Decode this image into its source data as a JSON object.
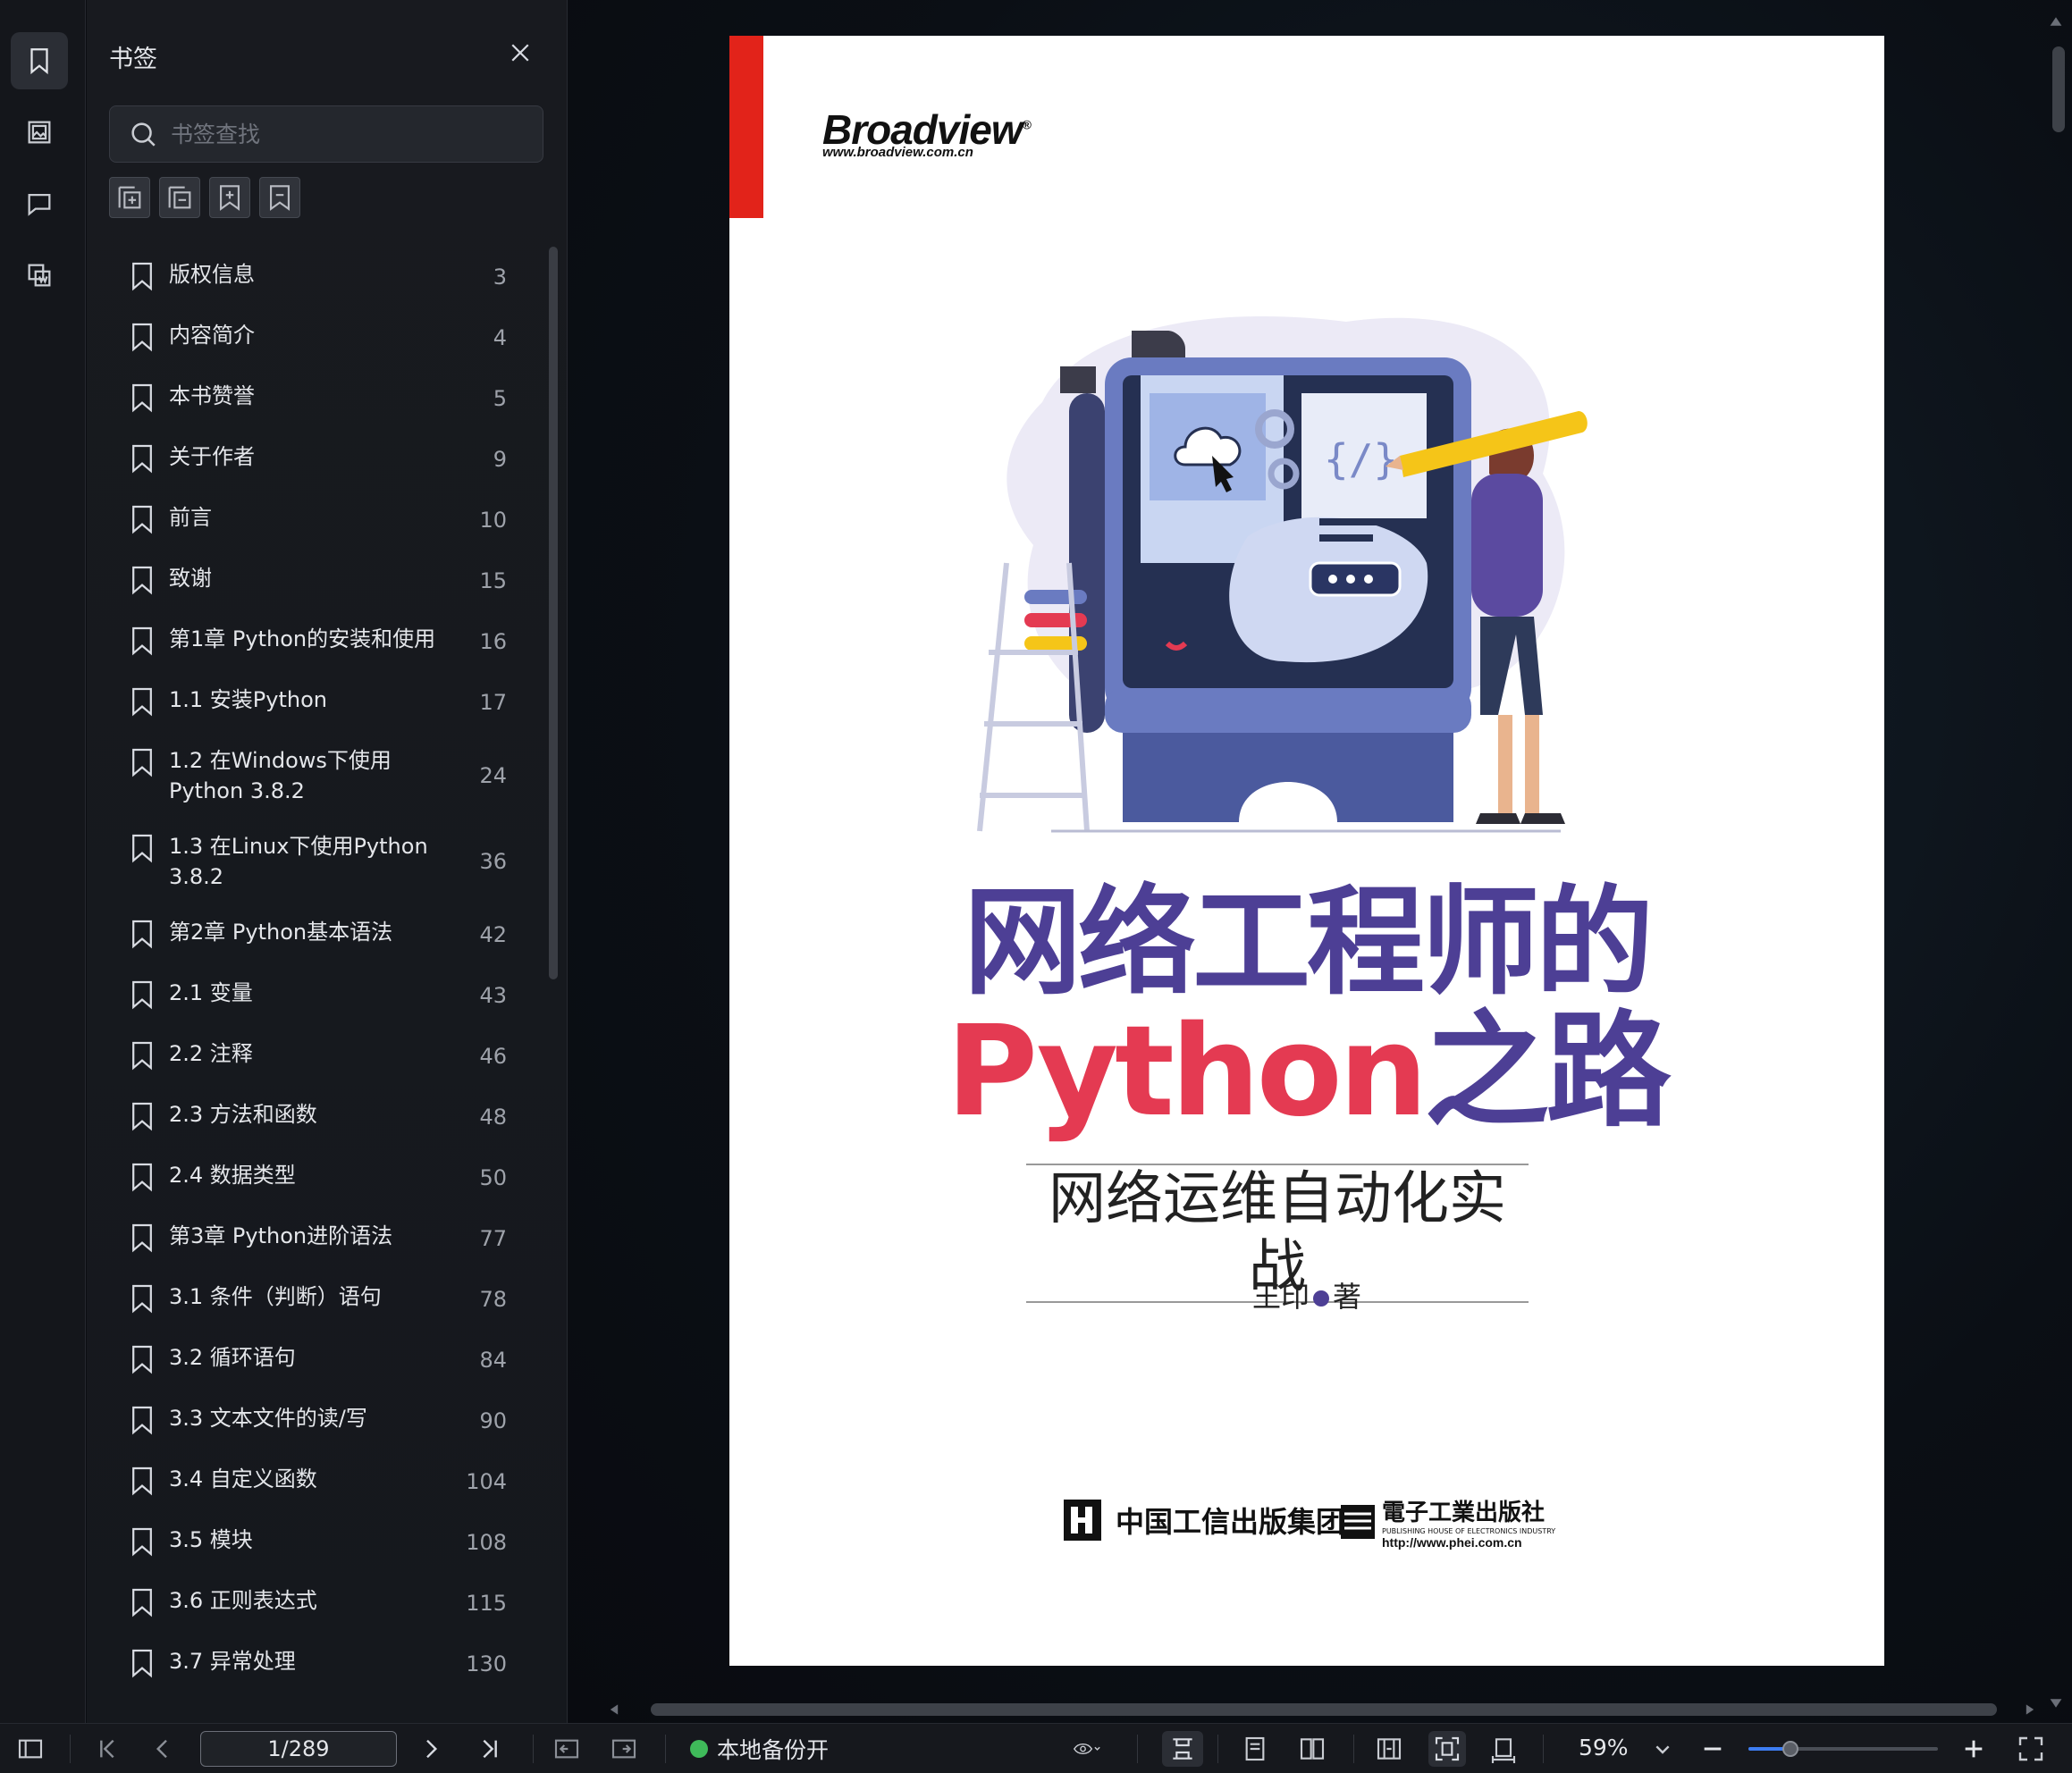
{
  "panel": {
    "title": "书签",
    "search_placeholder": "书签查找"
  },
  "bookmarks": [
    {
      "label": "版权信息",
      "page": "3"
    },
    {
      "label": "内容简介",
      "page": "4"
    },
    {
      "label": "本书赞誉",
      "page": "5"
    },
    {
      "label": "关于作者",
      "page": "9"
    },
    {
      "label": "前言",
      "page": "10"
    },
    {
      "label": "致谢",
      "page": "15"
    },
    {
      "label": "第1章 Python的安装和使用",
      "page": "16"
    },
    {
      "label": "1.1 安装Python",
      "page": "17"
    },
    {
      "label": "1.2 在Windows下使用Python 3.8.2",
      "page": "24"
    },
    {
      "label": "1.3 在Linux下使用Python 3.8.2",
      "page": "36"
    },
    {
      "label": "第2章 Python基本语法",
      "page": "42"
    },
    {
      "label": "2.1 变量",
      "page": "43"
    },
    {
      "label": "2.2 注释",
      "page": "46"
    },
    {
      "label": "2.3 方法和函数",
      "page": "48"
    },
    {
      "label": "2.4 数据类型",
      "page": "50"
    },
    {
      "label": "第3章 Python进阶语法",
      "page": "77"
    },
    {
      "label": "3.1 条件（判断）语句",
      "page": "78"
    },
    {
      "label": "3.2 循环语句",
      "page": "84"
    },
    {
      "label": "3.3 文本文件的读/写",
      "page": "90"
    },
    {
      "label": "3.4 自定义函数",
      "page": "104"
    },
    {
      "label": "3.5 模块",
      "page": "108"
    },
    {
      "label": "3.6 正则表达式",
      "page": "115"
    },
    {
      "label": "3.7 异常处理",
      "page": "130"
    }
  ],
  "cover": {
    "brand": "Broadview",
    "brand_mark": "®",
    "brand_url": "www.broadview.com.cn",
    "title_line1": "网络工程师的",
    "title_python": "Python",
    "title_road": "之路",
    "subtitle": "网络运维自动化实战",
    "author_name": "王印",
    "author_role": "著",
    "publisher1": "中国工信出版集团",
    "publisher2": "電子工業出版社",
    "publisher2_en": "PUBLISHING HOUSE OF ELECTRONICS INDUSTRY",
    "publisher2_url": "http://www.phei.com.cn"
  },
  "toolbar": {
    "page_indicator": "1/289",
    "backup_label": "本地备份开",
    "zoom": "59%",
    "zoom_fraction": 0.22
  },
  "colors": {
    "accent": "#3d7df2",
    "backup_status": "#3fba5a",
    "cover_purple": "#4d3f95",
    "cover_red": "#e43a52"
  }
}
